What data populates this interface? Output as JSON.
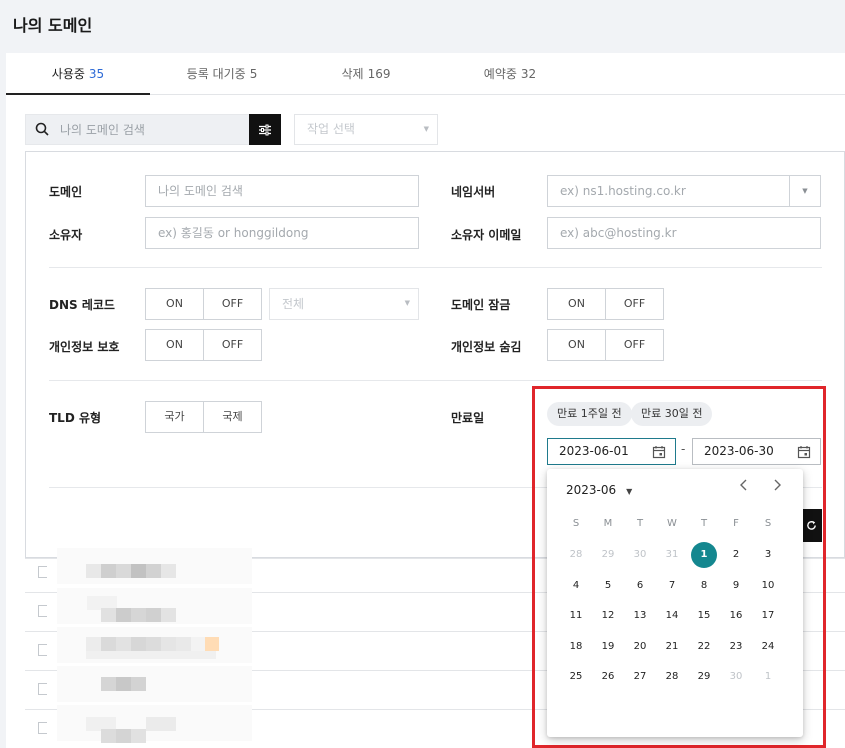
{
  "page": {
    "title": "나의 도메인"
  },
  "tabs": [
    {
      "label": "사용중",
      "count": "35"
    },
    {
      "label": "등록 대기중",
      "count": "5"
    },
    {
      "label": "삭제",
      "count": "169"
    },
    {
      "label": "예약중",
      "count": "32"
    }
  ],
  "search": {
    "placeholder": "나의 도메인 검색",
    "value": ""
  },
  "action_select": {
    "placeholder": "작업 선택"
  },
  "filters": {
    "domain": {
      "label": "도메인",
      "placeholder": "나의 도메인 검색"
    },
    "nameserver": {
      "label": "네임서버",
      "placeholder": "ex) ns1.hosting.co.kr"
    },
    "owner": {
      "label": "소유자",
      "placeholder": "ex) 홍길동 or honggildong"
    },
    "owner_email": {
      "label": "소유자 이메일",
      "placeholder": "ex) abc@hosting.kr"
    },
    "dns_record": {
      "label": "DNS 레코드",
      "on": "ON",
      "off": "OFF",
      "select_placeholder": "전체"
    },
    "domain_lock": {
      "label": "도메인 잠금",
      "on": "ON",
      "off": "OFF"
    },
    "privacy_protect": {
      "label": "개인정보 보호",
      "on": "ON",
      "off": "OFF"
    },
    "privacy_hide": {
      "label": "개인정보 숨김",
      "on": "ON",
      "off": "OFF"
    },
    "tld_type": {
      "label": "TLD 유형",
      "domestic": "국가",
      "international": "국제"
    },
    "expiry": {
      "label": "만료일",
      "chip_week": "만료 1주일 전",
      "chip_month": "만료 30일 전",
      "start": "2023-06-01",
      "separator": "-",
      "end": "2023-06-30"
    }
  },
  "calendar": {
    "month_label": "2023-06",
    "weekdays": [
      "S",
      "M",
      "T",
      "W",
      "T",
      "F",
      "S"
    ],
    "weeks": [
      [
        "28",
        "29",
        "30",
        "31",
        "1",
        "2",
        "3"
      ],
      [
        "4",
        "5",
        "6",
        "7",
        "8",
        "9",
        "10"
      ],
      [
        "11",
        "12",
        "13",
        "14",
        "15",
        "16",
        "17"
      ],
      [
        "18",
        "19",
        "20",
        "21",
        "22",
        "23",
        "24"
      ],
      [
        "25",
        "26",
        "27",
        "28",
        "29",
        "30",
        "1"
      ]
    ],
    "muted": [
      [
        0,
        0
      ],
      [
        0,
        1
      ],
      [
        0,
        2
      ],
      [
        0,
        3
      ],
      [
        4,
        5
      ],
      [
        4,
        6
      ]
    ],
    "selected": [
      0,
      4
    ],
    "accent_color": "#14878f"
  },
  "colors": {
    "highlight": "#e0262b",
    "tab_count_active": "#2d6ad6"
  }
}
